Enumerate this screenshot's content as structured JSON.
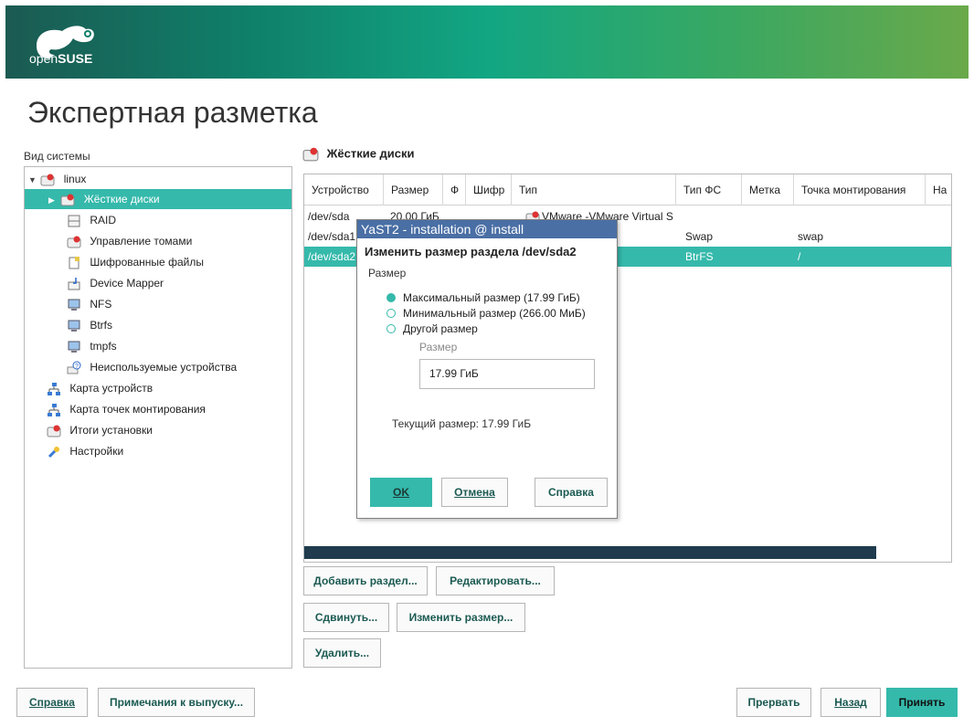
{
  "brand": {
    "logo_text_light": "open",
    "logo_text_bold": "SUSE"
  },
  "page_title": "Экспертная разметка",
  "left_panel": {
    "label": "Вид системы",
    "items": [
      {
        "label": "linux",
        "icon": "hard-disk-icon"
      },
      {
        "label": "Жёсткие диски",
        "icon": "hard-disk-icon"
      },
      {
        "label": "RAID",
        "icon": "raid-icon"
      },
      {
        "label": "Управление томами",
        "icon": "volume-management-icon"
      },
      {
        "label": "Шифрованные файлы",
        "icon": "encrypted-file-icon"
      },
      {
        "label": "Device Mapper",
        "icon": "device-mapper-icon"
      },
      {
        "label": "NFS",
        "icon": "nfs-icon"
      },
      {
        "label": "Btrfs",
        "icon": "btrfs-icon"
      },
      {
        "label": "tmpfs",
        "icon": "tmpfs-icon"
      },
      {
        "label": "Неиспользуемые устройства",
        "icon": "unused-devices-icon"
      },
      {
        "label": "Карта устройств",
        "icon": "device-graph-icon"
      },
      {
        "label": "Карта точек монтирования",
        "icon": "mount-graph-icon"
      },
      {
        "label": "Итоги установки",
        "icon": "installation-summary-icon"
      },
      {
        "label": "Настройки",
        "icon": "settings-icon"
      }
    ]
  },
  "right_panel": {
    "title": "Жёсткие диски",
    "columns": [
      "Устройство",
      "Размер",
      "Ф",
      "Шифр",
      "Тип",
      "Тип ФС",
      "Метка",
      "Точка монтирования",
      "На"
    ],
    "rows": [
      {
        "device": "/dev/sda",
        "size": "20.00 ГиБ",
        "type": "VMware -VMware Virtual S",
        "fs": "",
        "mount": ""
      },
      {
        "device": "/dev/sda1",
        "size": "",
        "type": "",
        "fs": "Swap",
        "mount": "swap"
      },
      {
        "device": "/dev/sda2",
        "size": "",
        "type": "",
        "fs": "BtrFS",
        "mount": "/"
      }
    ],
    "buttons": {
      "add": "Добавить раздел...",
      "edit": "Редактировать...",
      "move": "Сдвинуть...",
      "resize": "Изменить размер...",
      "delete": "Удалить..."
    }
  },
  "footer": {
    "help": "Справка",
    "release_notes": "Примечания к выпуску...",
    "abort": "Прервать",
    "back": "Назад",
    "accept": "Принять"
  },
  "dialog": {
    "window_title": "YaST2 - installation @ install",
    "heading": "Изменить размер раздела /dev/sda2",
    "size_group_label": "Размер",
    "options": [
      {
        "label": "Максимальный размер (17.99 ГиБ)",
        "checked": true
      },
      {
        "label": "Минимальный размер (266.00 МиБ)",
        "checked": false
      },
      {
        "label": "Другой размер",
        "checked": false
      }
    ],
    "custom_size_label": "Размер",
    "custom_size_value": "17.99 ГиБ",
    "current_size": "Текущий размер: 17.99 ГиБ",
    "ok": "OK",
    "cancel": "Отмена",
    "help": "Справка"
  },
  "colors": {
    "accent": "#35b9ab",
    "title_bar": "#4a6fa5",
    "scrollbar": "#1f3b4d"
  }
}
